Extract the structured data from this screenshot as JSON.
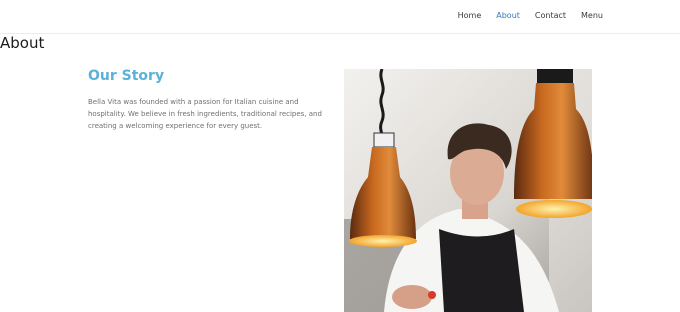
{
  "nav": {
    "items": [
      {
        "label": "Home"
      },
      {
        "label": "About"
      },
      {
        "label": "Contact"
      },
      {
        "label": "Menu"
      }
    ],
    "active_color": "#3a78b8"
  },
  "page": {
    "heading": "About"
  },
  "story": {
    "title": "Our Story",
    "title_color": "#5bb1d8",
    "body": "Bella Vita was founded with a passion for Italian cuisine and hospitality. We believe in fresh ingredients, traditional recipes, and creating a welcoming experience for every guest."
  }
}
